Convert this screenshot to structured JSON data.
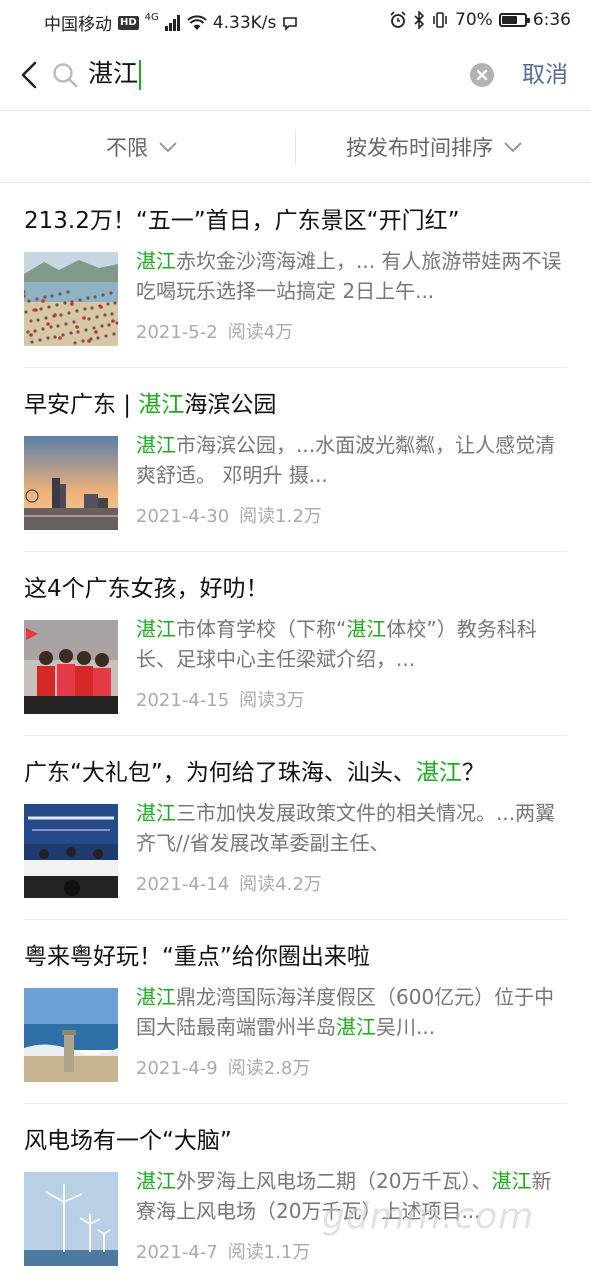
{
  "status_bar": {
    "carrier": "中国移动",
    "hd": "HD",
    "network": "4G",
    "speed": "4.33K/s",
    "battery_percent_text": "70%",
    "battery_level": 0.7,
    "time": "6:36"
  },
  "search": {
    "query": "湛江",
    "cancel_label": "取消"
  },
  "filters": {
    "range_label": "不限",
    "sort_label": "按发布时间排序"
  },
  "results": [
    {
      "title": [
        {
          "t": "213.2万！“五一”首日，广东景区“开门红”",
          "hl": false
        }
      ],
      "snippet": [
        {
          "t": "湛江",
          "hl": true
        },
        {
          "t": "赤坎金沙湾海滩上，... 有人旅游带娃两不误 吃喝玩乐选择一站搞定 2日上午...",
          "hl": false
        }
      ],
      "date": "2021-5-2",
      "reads": "阅读4万",
      "thumb": "beach-crowd"
    },
    {
      "title": [
        {
          "t": "早安广东 | ",
          "hl": false
        },
        {
          "t": "湛江",
          "hl": true
        },
        {
          "t": "海滨公园",
          "hl": false
        }
      ],
      "snippet": [
        {
          "t": "湛江",
          "hl": true
        },
        {
          "t": "市海滨公园，...水面波光粼粼，让人感觉清爽舒适。 邓明升 摄...",
          "hl": false
        }
      ],
      "date": "2021-4-30",
      "reads": "阅读1.2万",
      "thumb": "sunset-city"
    },
    {
      "title": [
        {
          "t": "这4个广东女孩，好叻！",
          "hl": false
        }
      ],
      "snippet": [
        {
          "t": "湛江",
          "hl": true
        },
        {
          "t": "市体育学校（下称“",
          "hl": false
        },
        {
          "t": "湛江",
          "hl": true
        },
        {
          "t": "体校”）教务科科长、足球中心主任梁斌介绍，...",
          "hl": false
        }
      ],
      "date": "2021-4-15",
      "reads": "阅读3万",
      "thumb": "girls-red"
    },
    {
      "title": [
        {
          "t": "广东“大礼包”，为何给了珠海、汕头、",
          "hl": false
        },
        {
          "t": "湛江",
          "hl": true
        },
        {
          "t": "？",
          "hl": false
        }
      ],
      "snippet": [
        {
          "t": "湛江",
          "hl": true
        },
        {
          "t": "三市加快发展政策文件的相关情况。...两翼齐飞//省发展改革委副主任、",
          "hl": false
        }
      ],
      "date": "2021-4-14",
      "reads": "阅读4.2万",
      "thumb": "press-conference"
    },
    {
      "title": [
        {
          "t": "粤来粤好玩！“重点”给你圈出来啦",
          "hl": false
        }
      ],
      "snippet": [
        {
          "t": "湛江",
          "hl": true
        },
        {
          "t": "鼎龙湾国际海洋度假区（600亿元）位于中国大陆最南端雷州半岛",
          "hl": false
        },
        {
          "t": "湛江",
          "hl": true
        },
        {
          "t": "吴川...",
          "hl": false
        }
      ],
      "date": "2021-4-9",
      "reads": "阅读2.8万",
      "thumb": "sea-tower"
    },
    {
      "title": [
        {
          "t": "风电场有一个“大脑”",
          "hl": false
        }
      ],
      "snippet": [
        {
          "t": "湛江",
          "hl": true
        },
        {
          "t": "外罗海上风电场二期（20万千瓦）、",
          "hl": false
        },
        {
          "t": "湛江",
          "hl": true
        },
        {
          "t": "新寮海上风电场（20万千瓦）上述项目...",
          "hl": false
        }
      ],
      "date": "2021-4-7",
      "reads": "阅读1.1万",
      "thumb": "wind-turbines"
    }
  ],
  "watermark": "gdmm.com",
  "colors": {
    "highlight": "#1aad19",
    "cancel": "#576b95",
    "meta": "#aaaaaa"
  }
}
